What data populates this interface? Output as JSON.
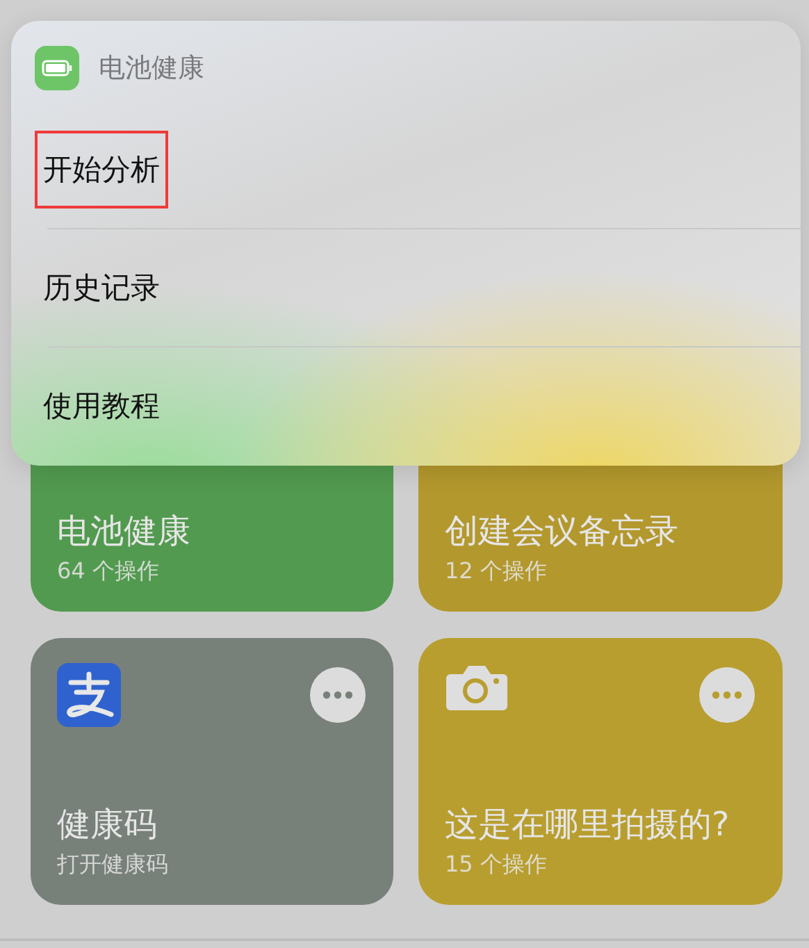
{
  "menu": {
    "title": "电池健康",
    "items": [
      {
        "label": "开始分析",
        "highlighted": true
      },
      {
        "label": "历史记录",
        "highlighted": false
      },
      {
        "label": "使用教程",
        "highlighted": false
      }
    ]
  },
  "shortcuts": [
    {
      "title": "电池健康",
      "subtitle": "64 个操作",
      "color": "#529a4f",
      "kind": "covered"
    },
    {
      "title": "创建会议备忘录",
      "subtitle": "12 个操作",
      "color": "#b3982d",
      "kind": "covered"
    },
    {
      "title": "健康码",
      "subtitle": "打开健康码",
      "color": "#78807a",
      "kind": "pay-app"
    },
    {
      "title": "这是在哪里拍摄的?",
      "subtitle": "15 个操作",
      "color": "#b89e2f",
      "kind": "camera"
    }
  ]
}
